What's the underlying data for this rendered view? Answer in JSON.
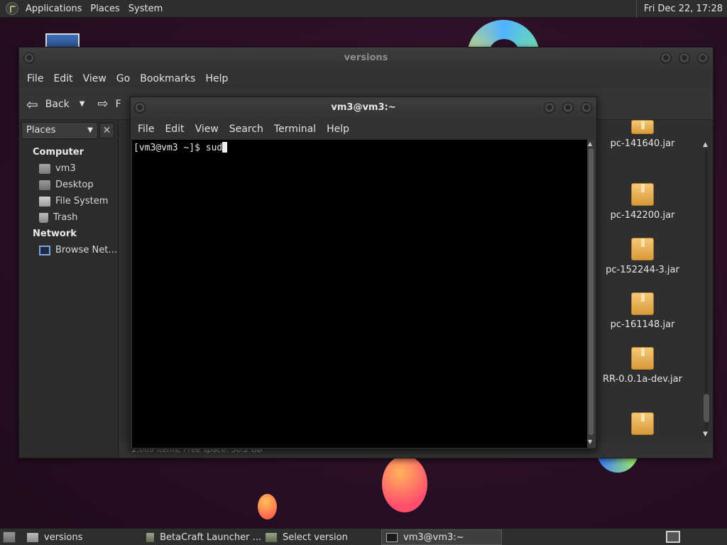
{
  "colors": {
    "desktop_bg": "#2a0f26",
    "panel_bg": "#2e2e2e",
    "window_bg": "#2f2f2f",
    "terminal_bg": "#000000"
  },
  "top_panel": {
    "logo_icon": "gnome-foot-icon",
    "menus": [
      "Applications",
      "Places",
      "System"
    ],
    "clock": "Fri Dec 22, 17:28"
  },
  "file_manager": {
    "title": "versions",
    "menus": [
      "File",
      "Edit",
      "View",
      "Go",
      "Bookmarks",
      "Help"
    ],
    "toolbar": {
      "back_label": "Back",
      "forward_label": "F"
    },
    "sidebar": {
      "combo_label": "Places",
      "close_glyph": "✕",
      "computer_heading": "Computer",
      "network_heading": "Network",
      "computer_items": [
        "vm3",
        "Desktop",
        "File System",
        "Trash"
      ],
      "network_items": [
        "Browse Net…"
      ]
    },
    "files": [
      "pc-141640.jar",
      "pc-142200.jar",
      "pc-152244-3.jar",
      "pc-161148.jar",
      "RR-0.0.1a-dev.jar",
      ""
    ],
    "status": "2,009 items, Free space: 30.2 GB"
  },
  "terminal": {
    "title": "vm3@vm3:~",
    "menus": [
      "File",
      "Edit",
      "View",
      "Search",
      "Terminal",
      "Help"
    ],
    "prompt": "[vm3@vm3 ~]$ ",
    "input": "sud"
  },
  "bottom_panel": {
    "tasks": [
      {
        "label": "versions",
        "icon": "folder-icon"
      },
      {
        "label": "BetaCraft Launcher ...",
        "icon": "java-icon"
      },
      {
        "label": "Select version",
        "icon": "java-icon"
      },
      {
        "label": "vm3@vm3:~",
        "icon": "terminal-icon"
      }
    ]
  }
}
